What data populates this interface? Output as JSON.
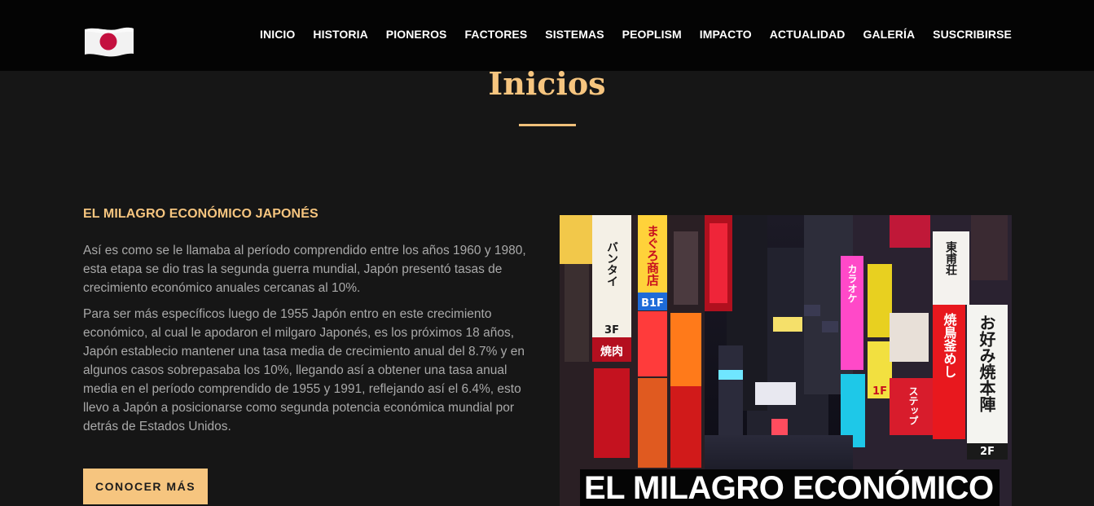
{
  "brand": {
    "logo_icon": "japan-flag-icon",
    "colors": {
      "flag_field": "#f2f2f2",
      "flag_disc": "#c4103f"
    }
  },
  "nav": {
    "items": [
      {
        "label": "INICIO"
      },
      {
        "label": "HISTORIA"
      },
      {
        "label": "PIONEROS"
      },
      {
        "label": "FACTORES"
      },
      {
        "label": "SISTEMAS"
      },
      {
        "label": "PEOPLISM"
      },
      {
        "label": "IMPACTO"
      },
      {
        "label": "ACTUALIDAD"
      },
      {
        "label": "GALERÍA"
      },
      {
        "label": "SUSCRIBIRSE"
      }
    ]
  },
  "page": {
    "title": "Inicios"
  },
  "section": {
    "heading": "EL MILAGRO ECONÓMICO JAPONÉS",
    "paragraphs": [
      "Así es como se le llamaba al período comprendido entre los años 1960 y 1980, esta etapa se dio tras la segunda guerra mundial, Japón presentó tasas de crecimiento económico anuales cercanas al 10%.",
      "Para ser más específicos luego de 1955 Japón entro en este crecimiento económico, al cual le apodaron el milgaro Japonés, es los próximos 18 años, Japón establecio mantener una tasa media de crecimiento anual del 8.7% y en algunos casos sobrepasaba los 10%, llegando así a obtener una tasa anual media en el período comprendido de 1955 y 1991, reflejando así el 6.4%, esto llevo a Japón a posicionarse como segunda potencia económica mundial por detrás de Estados Unidos."
    ],
    "cta_label": "CONOCER MÁS"
  },
  "feature_image": {
    "caption": "EL MILAGRO ECONÓMICO",
    "signs": [
      {
        "text": "バンタイ"
      },
      {
        "text": "まぐろ商店"
      },
      {
        "text": "B1F"
      },
      {
        "text": "3F"
      },
      {
        "text": "焼肉"
      },
      {
        "text": "東甫荘"
      },
      {
        "text": "焼鳥釜めし"
      },
      {
        "text": "お好み焼本陣"
      },
      {
        "text": "2F"
      },
      {
        "text": "カラオケ"
      },
      {
        "text": "ステップ"
      },
      {
        "text": "1F"
      }
    ]
  }
}
